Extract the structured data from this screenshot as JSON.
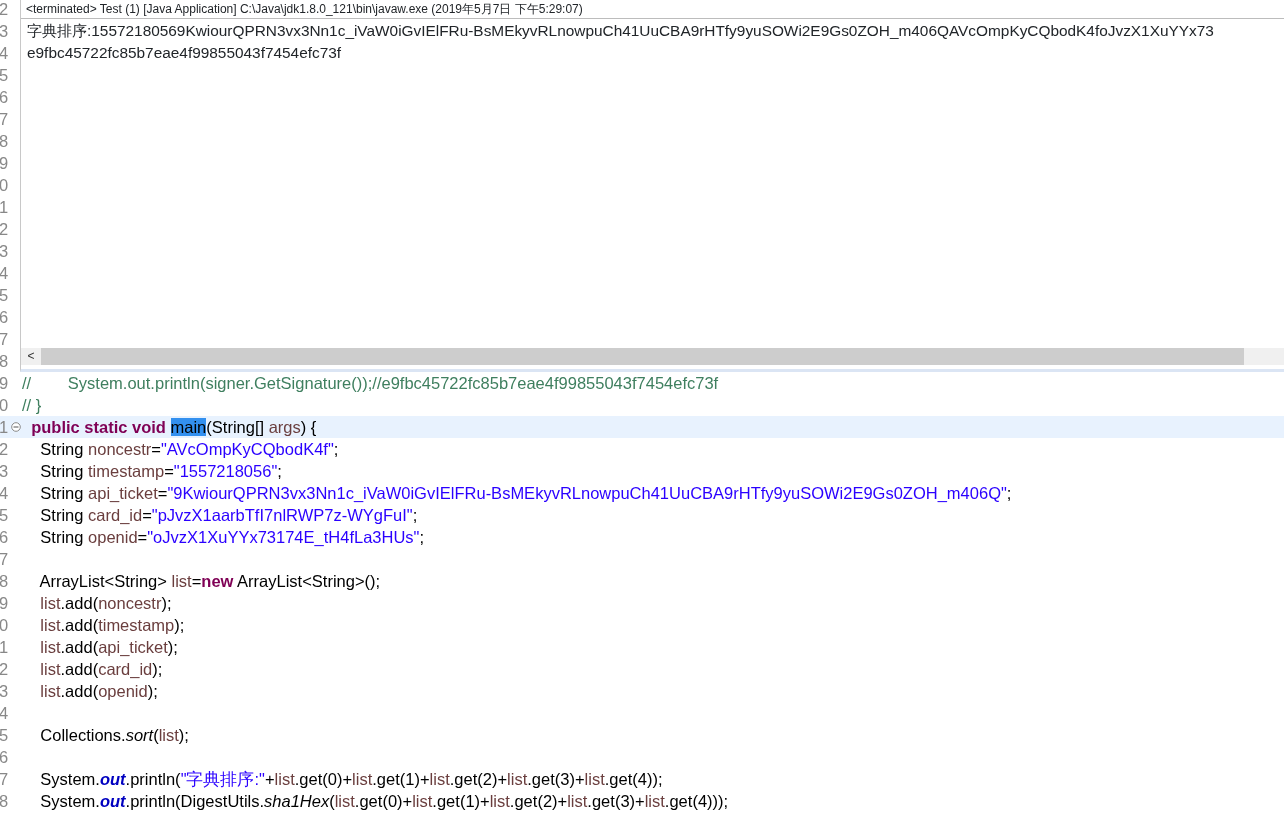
{
  "editor": {
    "hidden_line_numbers": [
      "2",
      "3",
      "4",
      "5",
      "6",
      "7",
      "8",
      "9",
      "0",
      "1",
      "2",
      "3",
      "4",
      "5",
      "6",
      "7",
      "8"
    ],
    "lines": [
      {
        "number": "9",
        "current": false,
        "fold_marker": false,
        "tokens": [
          {
            "kind": "comment",
            "text": "//        System.out.println(signer.GetSignature());//e9fbc45722fc85b7eae4f99855043f7454efc73f"
          }
        ]
      },
      {
        "number": "0",
        "current": false,
        "fold_marker": false,
        "tokens": [
          {
            "kind": "comment",
            "text": "// }"
          }
        ]
      },
      {
        "number": "1",
        "current": true,
        "fold_marker": true,
        "tokens": [
          {
            "kind": "keyword",
            "text": "  public static void "
          },
          {
            "kind": "selected",
            "text": "main"
          },
          {
            "kind": "plain",
            "text": "(String[] "
          },
          {
            "kind": "local",
            "text": "args"
          },
          {
            "kind": "plain",
            "text": ") {"
          }
        ]
      },
      {
        "number": "2",
        "current": false,
        "fold_marker": false,
        "tokens": [
          {
            "kind": "plain",
            "text": "    String "
          },
          {
            "kind": "local",
            "text": "noncestr"
          },
          {
            "kind": "plain",
            "text": "="
          },
          {
            "kind": "string",
            "text": "\"AVcOmpKyCQbodK4f\""
          },
          {
            "kind": "plain",
            "text": ";"
          }
        ]
      },
      {
        "number": "3",
        "current": false,
        "fold_marker": false,
        "tokens": [
          {
            "kind": "plain",
            "text": "    String "
          },
          {
            "kind": "local",
            "text": "timestamp"
          },
          {
            "kind": "plain",
            "text": "="
          },
          {
            "kind": "string",
            "text": "\"1557218056\""
          },
          {
            "kind": "plain",
            "text": ";"
          }
        ]
      },
      {
        "number": "4",
        "current": false,
        "fold_marker": false,
        "tokens": [
          {
            "kind": "plain",
            "text": "    String "
          },
          {
            "kind": "local",
            "text": "api_ticket"
          },
          {
            "kind": "plain",
            "text": "="
          },
          {
            "kind": "string",
            "text": "\"9KwiourQPRN3vx3Nn1c_iVaW0iGvIElFRu-BsMEkyvRLnowpuCh41UuCBA9rHTfy9yuSOWi2E9Gs0ZOH_m406Q\""
          },
          {
            "kind": "plain",
            "text": ";"
          }
        ]
      },
      {
        "number": "5",
        "current": false,
        "fold_marker": false,
        "tokens": [
          {
            "kind": "plain",
            "text": "    String "
          },
          {
            "kind": "local",
            "text": "card_id"
          },
          {
            "kind": "plain",
            "text": "="
          },
          {
            "kind": "string",
            "text": "\"pJvzX1aarbTfI7nlRWP7z-WYgFuI\""
          },
          {
            "kind": "plain",
            "text": ";"
          }
        ]
      },
      {
        "number": "6",
        "current": false,
        "fold_marker": false,
        "tokens": [
          {
            "kind": "plain",
            "text": "    String "
          },
          {
            "kind": "local",
            "text": "openid"
          },
          {
            "kind": "plain",
            "text": "="
          },
          {
            "kind": "string",
            "text": "\"oJvzX1XuYYx73174E_tH4fLa3HUs\""
          },
          {
            "kind": "plain",
            "text": ";"
          }
        ]
      },
      {
        "number": "7",
        "current": false,
        "fold_marker": false
      },
      {
        "number": "8",
        "current": false,
        "fold_marker": false,
        "tokens": [
          {
            "kind": "plain",
            "text": "    ArrayList<String> "
          },
          {
            "kind": "local",
            "text": "list"
          },
          {
            "kind": "plain",
            "text": "="
          },
          {
            "kind": "keyword",
            "text": "new"
          },
          {
            "kind": "plain",
            "text": " ArrayList<String>();"
          }
        ]
      },
      {
        "number": "9",
        "current": false,
        "fold_marker": false,
        "tokens": [
          {
            "kind": "local",
            "text": "    list"
          },
          {
            "kind": "plain",
            "text": ".add("
          },
          {
            "kind": "local",
            "text": "noncestr"
          },
          {
            "kind": "plain",
            "text": ");"
          }
        ]
      },
      {
        "number": "0",
        "current": false,
        "fold_marker": false,
        "tokens": [
          {
            "kind": "local",
            "text": "    list"
          },
          {
            "kind": "plain",
            "text": ".add("
          },
          {
            "kind": "local",
            "text": "timestamp"
          },
          {
            "kind": "plain",
            "text": ");"
          }
        ]
      },
      {
        "number": "1",
        "current": false,
        "fold_marker": false,
        "tokens": [
          {
            "kind": "local",
            "text": "    list"
          },
          {
            "kind": "plain",
            "text": ".add("
          },
          {
            "kind": "local",
            "text": "api_ticket"
          },
          {
            "kind": "plain",
            "text": ");"
          }
        ]
      },
      {
        "number": "2",
        "current": false,
        "fold_marker": false,
        "tokens": [
          {
            "kind": "local",
            "text": "    list"
          },
          {
            "kind": "plain",
            "text": ".add("
          },
          {
            "kind": "local",
            "text": "card_id"
          },
          {
            "kind": "plain",
            "text": ");"
          }
        ]
      },
      {
        "number": "3",
        "current": false,
        "fold_marker": false,
        "tokens": [
          {
            "kind": "local",
            "text": "    list"
          },
          {
            "kind": "plain",
            "text": ".add("
          },
          {
            "kind": "local",
            "text": "openid"
          },
          {
            "kind": "plain",
            "text": ");"
          }
        ]
      },
      {
        "number": "4",
        "current": false,
        "fold_marker": false
      },
      {
        "number": "5",
        "current": false,
        "fold_marker": false,
        "tokens": [
          {
            "kind": "plain",
            "text": "    Collections."
          },
          {
            "kind": "static-method",
            "text": "sort"
          },
          {
            "kind": "plain",
            "text": "("
          },
          {
            "kind": "local",
            "text": "list"
          },
          {
            "kind": "plain",
            "text": ");"
          }
        ]
      },
      {
        "number": "6",
        "current": false,
        "fold_marker": false
      },
      {
        "number": "7",
        "current": false,
        "fold_marker": false,
        "tokens": [
          {
            "kind": "plain",
            "text": "    System."
          },
          {
            "kind": "field",
            "text": "out"
          },
          {
            "kind": "plain",
            "text": ".println("
          },
          {
            "kind": "string",
            "text": "\"字典排序:\""
          },
          {
            "kind": "plain",
            "text": "+"
          },
          {
            "kind": "local",
            "text": "list"
          },
          {
            "kind": "plain",
            "text": ".get(0)+"
          },
          {
            "kind": "local",
            "text": "list"
          },
          {
            "kind": "plain",
            "text": ".get(1)+"
          },
          {
            "kind": "local",
            "text": "list"
          },
          {
            "kind": "plain",
            "text": ".get(2)+"
          },
          {
            "kind": "local",
            "text": "list"
          },
          {
            "kind": "plain",
            "text": ".get(3)+"
          },
          {
            "kind": "local",
            "text": "list"
          },
          {
            "kind": "plain",
            "text": ".get(4));"
          }
        ]
      },
      {
        "number": "8",
        "current": false,
        "fold_marker": false,
        "tokens": [
          {
            "kind": "plain",
            "text": "    System."
          },
          {
            "kind": "field",
            "text": "out"
          },
          {
            "kind": "plain",
            "text": ".println(DigestUtils."
          },
          {
            "kind": "static-method",
            "text": "sha1Hex"
          },
          {
            "kind": "plain",
            "text": "("
          },
          {
            "kind": "local",
            "text": "list"
          },
          {
            "kind": "plain",
            "text": ".get(0)+"
          },
          {
            "kind": "local",
            "text": "list"
          },
          {
            "kind": "plain",
            "text": ".get(1)+"
          },
          {
            "kind": "local",
            "text": "list"
          },
          {
            "kind": "plain",
            "text": ".get(2)+"
          },
          {
            "kind": "local",
            "text": "list"
          },
          {
            "kind": "plain",
            "text": ".get(3)+"
          },
          {
            "kind": "local",
            "text": "list"
          },
          {
            "kind": "plain",
            "text": ".get(4)));"
          }
        ]
      }
    ]
  },
  "console": {
    "title": "<terminated> Test (1) [Java Application] C:\\Java\\jdk1.8.0_121\\bin\\javaw.exe (2019年5月7日 下午5:29:07)",
    "output": [
      "字典排序:15572180569KwiourQPRN3vx3Nn1c_iVaW0iGvIElFRu-BsMEkyvRLnowpuCh41UuCBA9rHTfy9yuSOWi2E9Gs0ZOH_m406QAVcOmpKyCQbodK4foJvzX1XuYYx73",
      "e9fbc45722fc85b7eae4f99855043f7454efc73f"
    ],
    "scroll_arrow": "<"
  }
}
